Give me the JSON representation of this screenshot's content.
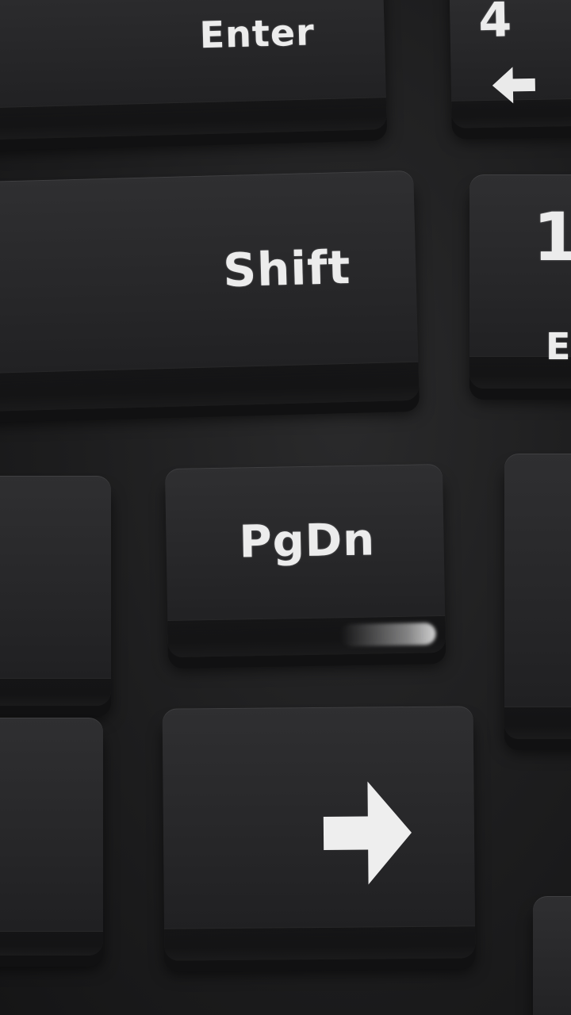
{
  "keys": {
    "enter": {
      "label": "Enter"
    },
    "shift": {
      "label": "Shift"
    },
    "pgdn": {
      "label": "PgDn"
    },
    "num4": {
      "label": "4"
    },
    "num1": {
      "label": "1"
    },
    "num1_sub": {
      "label": "E"
    }
  },
  "icons": {
    "right_arrow": "right-arrow-icon",
    "left_arrow": "left-arrow-icon"
  }
}
